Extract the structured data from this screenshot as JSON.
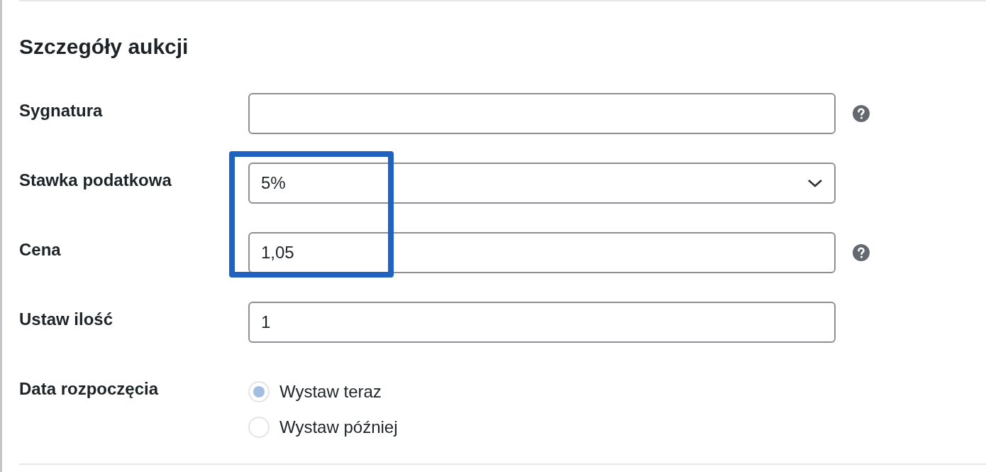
{
  "section": {
    "title": "Szczegóły aukcji"
  },
  "fields": [
    {
      "kind": "text",
      "label": "Sygnatura",
      "help": true
    },
    {
      "kind": "select",
      "label": "Stawka podatkowa",
      "value": "5%",
      "help": false
    },
    {
      "kind": "text",
      "label": "Cena",
      "value": "1,05",
      "help": true
    },
    {
      "kind": "text",
      "label": "Ustaw ilość",
      "value": "1",
      "help": false
    },
    {
      "kind": "radio",
      "label": "Data rozpoczęcia",
      "options": [
        {
          "label": "Wystaw teraz",
          "selected": true
        },
        {
          "label": "Wystaw później",
          "selected": false
        }
      ]
    }
  ]
}
